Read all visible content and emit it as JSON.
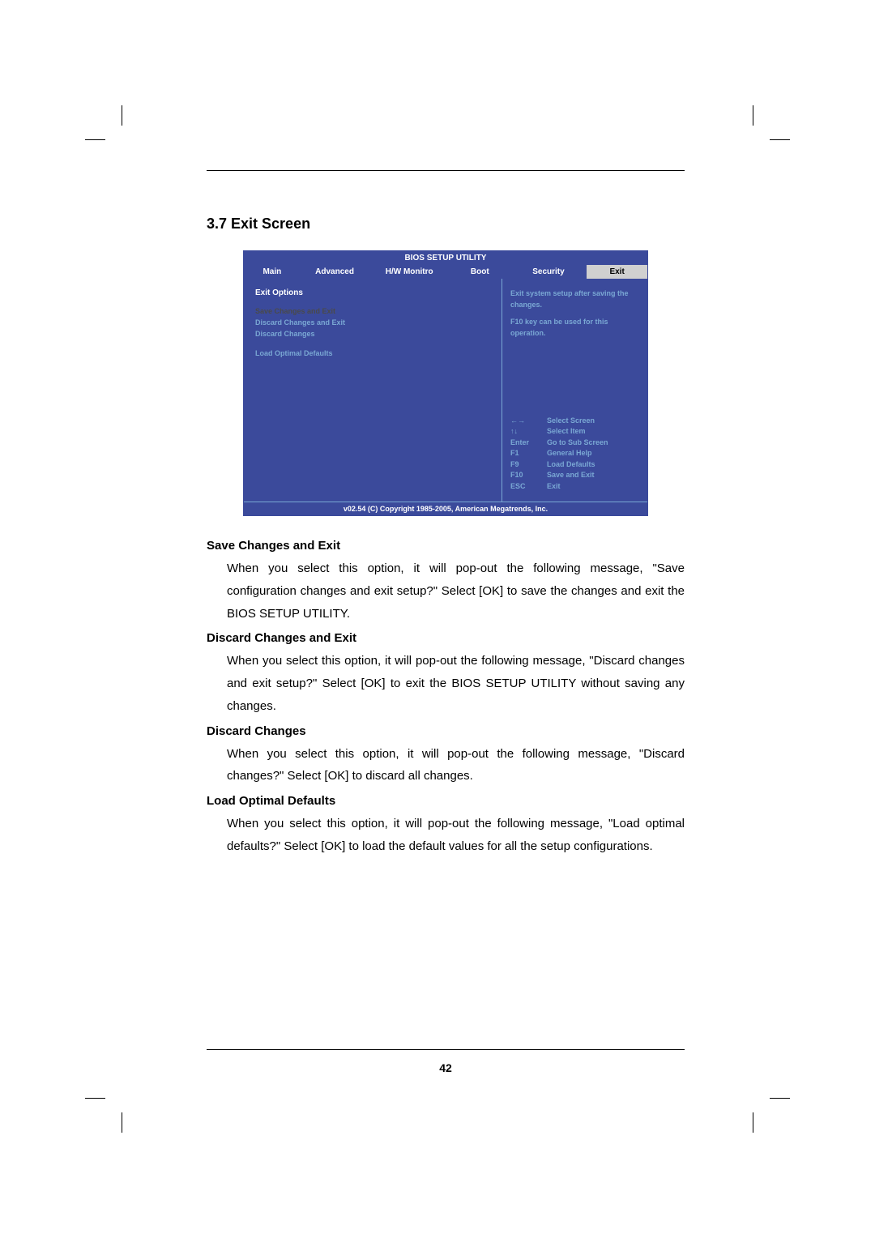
{
  "section": {
    "number": "3.7",
    "title": "Exit Screen",
    "heading": "3.7  Exit Screen"
  },
  "bios": {
    "title": "BIOS SETUP UTILITY",
    "tabs": {
      "main": "Main",
      "advanced": "Advanced",
      "hw": "H/W Monitro",
      "boot": "Boot",
      "security": "Security",
      "exit": "Exit"
    },
    "left": {
      "heading": "Exit Options",
      "options": [
        "Save Changes and Exit",
        "Discard Changes and Exit",
        "Discard Changes",
        "Load Optimal Defaults"
      ]
    },
    "help": {
      "line1": "Exit system setup after saving the changes.",
      "line2": "F10 key can be used for this operation."
    },
    "keys": [
      {
        "k": "←→",
        "v": "Select Screen"
      },
      {
        "k": "↑↓",
        "v": "Select Item"
      },
      {
        "k": "Enter",
        "v": "Go to Sub Screen"
      },
      {
        "k": "F1",
        "v": "General Help"
      },
      {
        "k": "F9",
        "v": "Load Defaults"
      },
      {
        "k": "F10",
        "v": "Save and Exit"
      },
      {
        "k": "ESC",
        "v": "Exit"
      }
    ],
    "footer": "v02.54 (C) Copyright 1985-2005, American Megatrends, Inc."
  },
  "descriptions": [
    {
      "title": "Save Changes and Exit",
      "text": "When you select this option, it will pop-out the following message, \"Save configuration changes and exit setup?\" Select [OK] to save the changes and exit the BIOS SETUP UTILITY."
    },
    {
      "title": "Discard Changes and Exit",
      "text": "When you select this option, it will pop-out the following message, \"Discard changes and exit setup?\" Select [OK] to exit the BIOS SETUP UTILITY without saving any changes."
    },
    {
      "title": "Discard Changes",
      "text": "When you select this option, it will pop-out the following message, \"Discard changes?\" Select [OK] to discard all changes."
    },
    {
      "title": "Load Optimal Defaults",
      "text": "When you select this option, it will pop-out the following message, \"Load optimal defaults?\" Select [OK] to load the default values for all the setup configurations."
    }
  ],
  "page_number": "42"
}
